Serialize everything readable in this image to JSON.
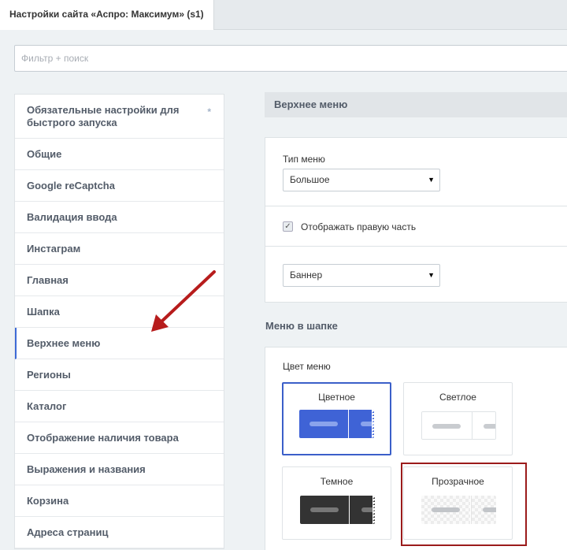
{
  "tab": {
    "title": "Настройки сайта «Аспро: Максимум» (s1)"
  },
  "filter": {
    "placeholder": "Фильтр + поиск"
  },
  "sidebar": {
    "items": [
      {
        "label": "Обязательные настройки для быстрого запуска",
        "starred": true
      },
      {
        "label": "Общие"
      },
      {
        "label": "Google reCaptcha"
      },
      {
        "label": "Валидация ввода"
      },
      {
        "label": "Инстаграм"
      },
      {
        "label": "Главная"
      },
      {
        "label": "Шапка"
      },
      {
        "label": "Верхнее меню",
        "active": true
      },
      {
        "label": "Регионы"
      },
      {
        "label": "Каталог"
      },
      {
        "label": "Отображение наличия товара"
      },
      {
        "label": "Выражения и названия"
      },
      {
        "label": "Корзина"
      },
      {
        "label": "Адреса страниц"
      }
    ],
    "star_glyph": "*"
  },
  "main": {
    "section_title": "Верхнее меню",
    "menu_type": {
      "label": "Тип меню",
      "value": "Большое"
    },
    "show_right": {
      "label": "Отображать правую часть",
      "checked": true
    },
    "right_part": {
      "value": "Баннер"
    },
    "header_menu_title": "Меню в шапке",
    "menu_color": {
      "label": "Цвет меню",
      "options": [
        {
          "label": "Цветное",
          "selected": true
        },
        {
          "label": "Светлое"
        },
        {
          "label": "Темное"
        },
        {
          "label": "Прозрачное",
          "highlighted": true
        }
      ]
    }
  },
  "colors": {
    "accent": "#3d6ad6",
    "annotation": "#b71c1c"
  }
}
